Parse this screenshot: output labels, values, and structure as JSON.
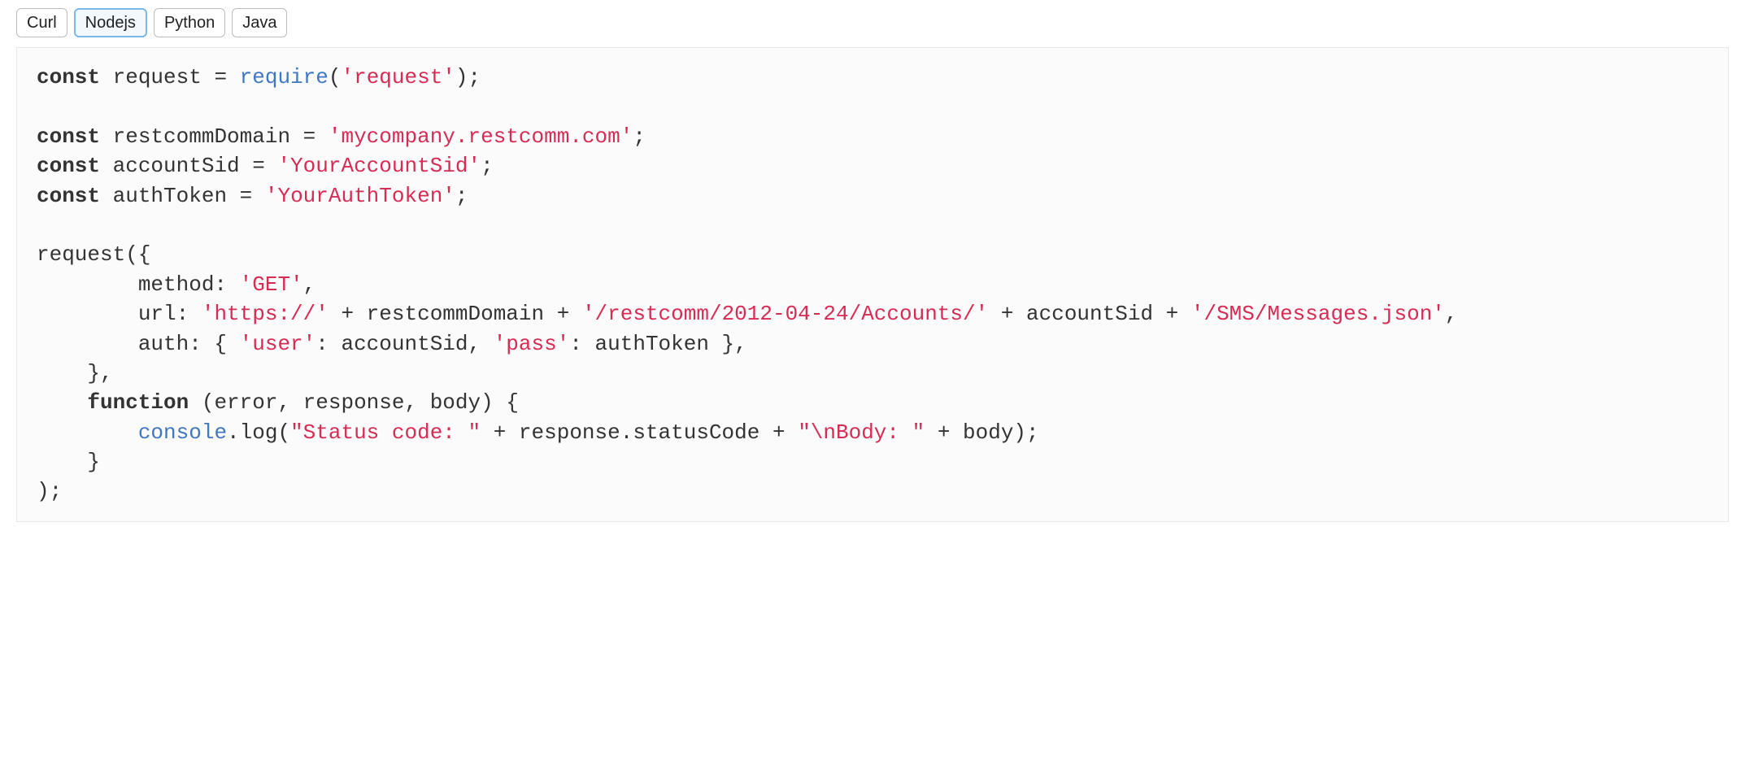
{
  "tabs": {
    "items": [
      {
        "label": "Curl",
        "active": false
      },
      {
        "label": "Nodejs",
        "active": true
      },
      {
        "label": "Python",
        "active": false
      },
      {
        "label": "Java",
        "active": false
      }
    ]
  },
  "code": {
    "tokens": [
      {
        "cls": "kw",
        "text": "const"
      },
      {
        "cls": "plain",
        "text": " request = "
      },
      {
        "cls": "fn",
        "text": "require"
      },
      {
        "cls": "plain",
        "text": "("
      },
      {
        "cls": "str",
        "text": "'request'"
      },
      {
        "cls": "plain",
        "text": ");\n\n"
      },
      {
        "cls": "kw",
        "text": "const"
      },
      {
        "cls": "plain",
        "text": " restcommDomain = "
      },
      {
        "cls": "str",
        "text": "'mycompany.restcomm.com'"
      },
      {
        "cls": "plain",
        "text": ";\n"
      },
      {
        "cls": "kw",
        "text": "const"
      },
      {
        "cls": "plain",
        "text": " accountSid = "
      },
      {
        "cls": "str",
        "text": "'YourAccountSid'"
      },
      {
        "cls": "plain",
        "text": ";\n"
      },
      {
        "cls": "kw",
        "text": "const"
      },
      {
        "cls": "plain",
        "text": " authToken = "
      },
      {
        "cls": "str",
        "text": "'YourAuthToken'"
      },
      {
        "cls": "plain",
        "text": ";\n\n"
      },
      {
        "cls": "plain",
        "text": "request({\n"
      },
      {
        "cls": "plain",
        "text": "        method: "
      },
      {
        "cls": "str",
        "text": "'GET'"
      },
      {
        "cls": "plain",
        "text": ",\n"
      },
      {
        "cls": "plain",
        "text": "        url: "
      },
      {
        "cls": "str",
        "text": "'https://'"
      },
      {
        "cls": "plain",
        "text": " + restcommDomain + "
      },
      {
        "cls": "str",
        "text": "'/restcomm/2012-04-24/Accounts/'"
      },
      {
        "cls": "plain",
        "text": " + accountSid + "
      },
      {
        "cls": "str",
        "text": "'/SMS/Messages.json'"
      },
      {
        "cls": "plain",
        "text": ",\n"
      },
      {
        "cls": "plain",
        "text": "        auth: { "
      },
      {
        "cls": "str",
        "text": "'user'"
      },
      {
        "cls": "plain",
        "text": ": accountSid, "
      },
      {
        "cls": "str",
        "text": "'pass'"
      },
      {
        "cls": "plain",
        "text": ": authToken },\n"
      },
      {
        "cls": "plain",
        "text": "    },\n"
      },
      {
        "cls": "plain",
        "text": "    "
      },
      {
        "cls": "kw",
        "text": "function"
      },
      {
        "cls": "plain",
        "text": " (error, response, body) {\n"
      },
      {
        "cls": "plain",
        "text": "        "
      },
      {
        "cls": "fn",
        "text": "console"
      },
      {
        "cls": "plain",
        "text": ".log("
      },
      {
        "cls": "str",
        "text": "\"Status code: \""
      },
      {
        "cls": "plain",
        "text": " + response.statusCode + "
      },
      {
        "cls": "str",
        "text": "\"\\nBody: \""
      },
      {
        "cls": "plain",
        "text": " + body);\n"
      },
      {
        "cls": "plain",
        "text": "    }\n"
      },
      {
        "cls": "plain",
        "text": ");"
      }
    ]
  }
}
